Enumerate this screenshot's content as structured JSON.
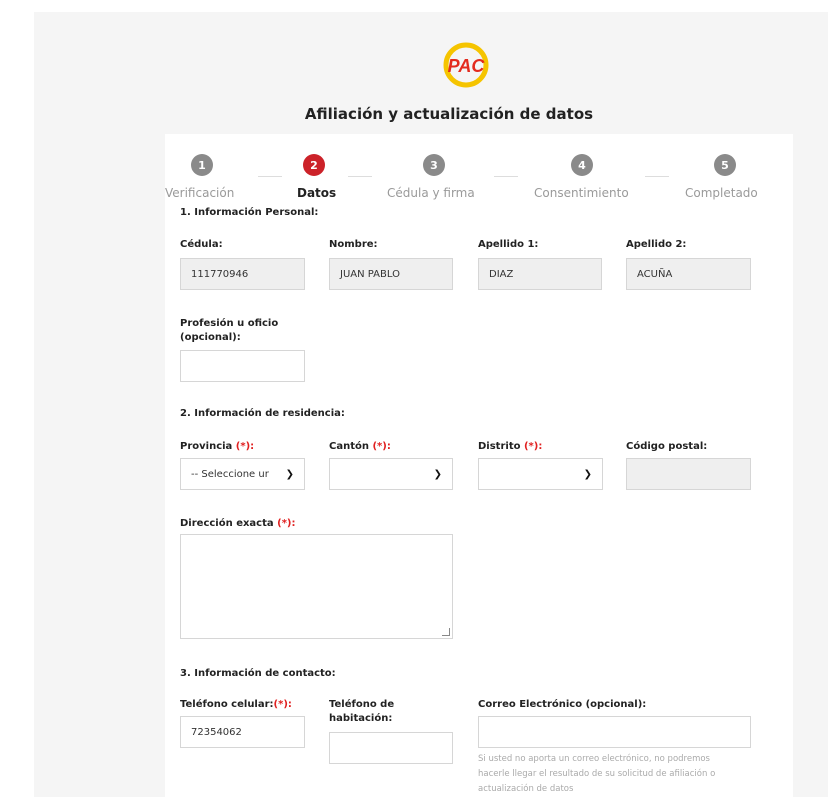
{
  "header": {
    "logo_text": "PAC",
    "title": "Afiliación y actualización de datos"
  },
  "stepper": [
    {
      "number": "1",
      "label": "Verificación",
      "active": false
    },
    {
      "number": "2",
      "label": "Datos",
      "active": true
    },
    {
      "number": "3",
      "label": "Cédula y firma",
      "active": false
    },
    {
      "number": "4",
      "label": "Consentimiento",
      "active": false
    },
    {
      "number": "5",
      "label": "Completado",
      "active": false
    }
  ],
  "personal": {
    "section_title": "1. Información Personal:",
    "cedula_label": "Cédula:",
    "cedula_value": "111770946",
    "nombre_label": "Nombre:",
    "nombre_value": "JUAN PABLO",
    "apellido1_label": "Apellido 1:",
    "apellido1_value": "DIAZ",
    "apellido2_label": "Apellido 2:",
    "apellido2_value": "ACUÑA",
    "profesion_label_1": "Profesión u oficio",
    "profesion_label_2": "(opcional):",
    "profesion_value": ""
  },
  "residencia": {
    "section_title": "2. Información de residencia:",
    "provincia_label": "Provincia ",
    "canton_label": "Cantón ",
    "distrito_label": "Distrito ",
    "required_mark": "(*):",
    "codigo_label": "Código postal:",
    "provincia_value": "-- Seleccione ur",
    "canton_value": "",
    "distrito_value": "",
    "codigo_value": "",
    "direccion_label": "Dirección exacta "
  },
  "contacto": {
    "section_title": "3. Información de contacto:",
    "celular_label": "Teléfono celular:",
    "celular_value": "72354062",
    "habitacion_label_1": "Teléfono de",
    "habitacion_label_2": "habitación:",
    "habitacion_value": "",
    "correo_label": "Correo Electrónico (opcional):",
    "correo_value": "",
    "correo_help_1": "Si usted no aporta un correo electrónico, no podremos",
    "correo_help_2": "hacerle llegar el resultado de su solicitud de afiliación o",
    "correo_help_3": "actualización de datos"
  },
  "colors": {
    "accent_red": "#cc2229",
    "step_gray": "#8a8a8a",
    "logo_yellow": "#f5c400"
  }
}
